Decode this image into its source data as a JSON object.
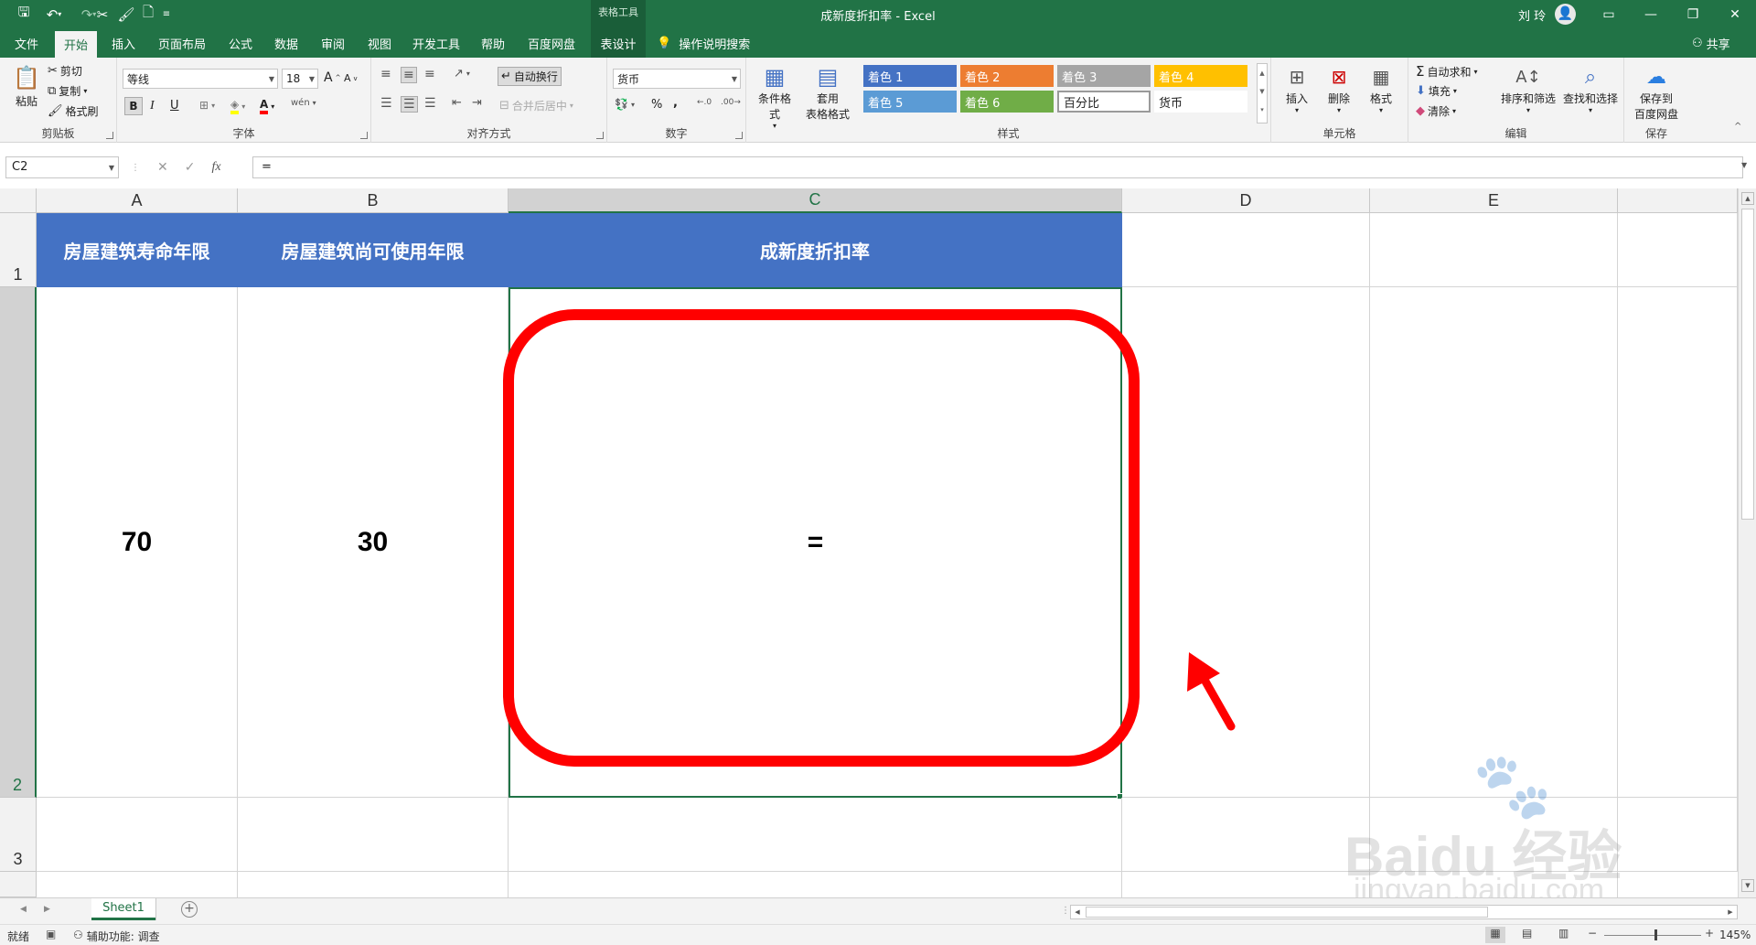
{
  "window": {
    "title": "成新度折扣率  -  Excel",
    "contextual_tools_label": "表格工具",
    "user_name": "刘 玲",
    "accent_color": "#217346"
  },
  "quick_access": {
    "icons": [
      "save-icon",
      "undo-icon",
      "redo-icon",
      "cut-icon",
      "format-painter-icon",
      "new-file-icon",
      "customize-icon"
    ]
  },
  "tabs": [
    {
      "label": "文件"
    },
    {
      "label": "开始"
    },
    {
      "label": "插入"
    },
    {
      "label": "页面布局"
    },
    {
      "label": "公式"
    },
    {
      "label": "数据"
    },
    {
      "label": "审阅"
    },
    {
      "label": "视图"
    },
    {
      "label": "开发工具"
    },
    {
      "label": "帮助"
    },
    {
      "label": "百度网盘"
    },
    {
      "label": "表设计"
    }
  ],
  "active_tab": "开始",
  "search_label": "操作说明搜索",
  "share_label": "共享",
  "ribbon": {
    "clipboard": {
      "paste": "粘贴",
      "cut": "剪切",
      "copy": "复制",
      "format_painter": "格式刷",
      "group": "剪贴板"
    },
    "font": {
      "name": "等线",
      "size": "18",
      "group": "字体",
      "bold": "B",
      "italic": "I",
      "underline": "U",
      "font_color": "A",
      "phonetic": "wén"
    },
    "alignment": {
      "wrap_text": "自动换行",
      "merge_center": "合并后居中",
      "group": "对齐方式"
    },
    "number": {
      "format": "货币",
      "group": "数字",
      "percent": "%",
      "comma": ","
    },
    "styles": {
      "conditional": "条件格式",
      "table_format_1": "套用",
      "table_format_2": "表格格式",
      "group": "样式",
      "items": [
        {
          "label": "着色 1",
          "color": "#4472c4",
          "text_color": "#ffffff"
        },
        {
          "label": "着色 2",
          "color": "#ed7d31",
          "text_color": "#ffffff"
        },
        {
          "label": "着色 3",
          "color": "#a5a5a5",
          "text_color": "#ffffff"
        },
        {
          "label": "着色 4",
          "color": "#ffc000",
          "text_color": "#ffffff"
        },
        {
          "label": "着色 5",
          "color": "#5b9bd5",
          "text_color": "#ffffff"
        },
        {
          "label": "着色 6",
          "color": "#70ad47",
          "text_color": "#ffffff"
        },
        {
          "label": "百分比",
          "color": "#ffffff",
          "text_color": "#222222"
        },
        {
          "label": "货币",
          "color": "#ffffff",
          "text_color": "#222222"
        }
      ]
    },
    "cells": {
      "insert": "插入",
      "delete": "删除",
      "format": "格式",
      "group": "单元格"
    },
    "editing": {
      "autosum": "自动求和",
      "fill": "填充",
      "clear": "清除",
      "sort_filter": "排序和筛选",
      "find_select": "查找和选择",
      "group": "编辑"
    },
    "save": {
      "label_1": "保存到",
      "label_2": "百度网盘",
      "group": "保存"
    }
  },
  "formula_bar": {
    "name_box": "C2",
    "formula": "="
  },
  "grid": {
    "columns": [
      "A",
      "B",
      "C",
      "D",
      "E"
    ],
    "selected_column": "C",
    "rows": [
      "1",
      "2",
      "3"
    ],
    "selected_row": "2",
    "header_fill": "#4472c4",
    "cells": {
      "A1": "房屋建筑寿命年限",
      "B1": "房屋建筑尚可使用年限",
      "C1": "成新度折扣率",
      "A2": "70",
      "B2": "30",
      "C2": "="
    },
    "annotation_color": "#ff0000"
  },
  "sheet_tabs": [
    {
      "label": "Sheet1",
      "active": true
    }
  ],
  "status": {
    "ready": "就绪",
    "accessibility": "辅助功能: 调查",
    "zoom": "145%"
  },
  "watermark": {
    "brand": "Baidu",
    "cn": "经验",
    "url": "jingyan.baidu.com"
  }
}
